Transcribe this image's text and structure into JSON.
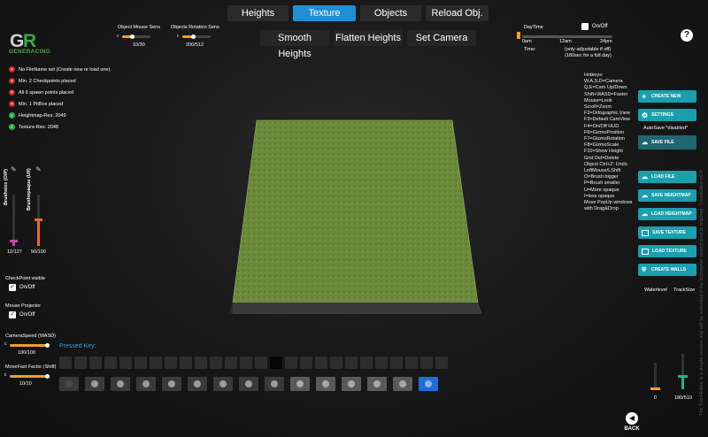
{
  "tabs": [
    {
      "label": "Heights",
      "active": false
    },
    {
      "label": "Texture",
      "active": true
    },
    {
      "label": "Objects",
      "active": false
    },
    {
      "label": "Reload Obj.",
      "active": false
    }
  ],
  "tools": {
    "smooth": "Smooth Heights",
    "flatten": "Flatten Heights",
    "camera": "Set Camera"
  },
  "logo": {
    "text": "GENERACING",
    "letters": "GR"
  },
  "mouse_sens": {
    "label": "Object Mouse Sens",
    "value": "10/30",
    "level": 0.33
  },
  "rot_sens": {
    "label": "Objects Rotation Sens",
    "value": "200/512",
    "level": 0.39
  },
  "daytime": {
    "label": "DayTime",
    "toggle_label": "On/Off",
    "t0": "0am",
    "t1": "12am",
    "t2": "24pm",
    "time_label": "Time:",
    "note1": "(only adjustable if off)",
    "note2": "(180sec for a full day)"
  },
  "help_icon": "?",
  "status": [
    {
      "ok": false,
      "text": "No FileName set (Create new or load one)"
    },
    {
      "ok": false,
      "text": "Min. 2 Checkpoints placed"
    },
    {
      "ok": false,
      "text": "All 6 spawn points placed"
    },
    {
      "ok": false,
      "text": "Min. 1 PitBox placed"
    },
    {
      "ok": true,
      "text": "Heightmap-Res: 2049"
    },
    {
      "ok": true,
      "text": "Texture-Res: 2048"
    }
  ],
  "brush": {
    "size_label": "Brushsize (O/P)",
    "opaque_label": "Brushopaque (U/I)",
    "size_value": "12/127",
    "opaque_value": "50/100",
    "size_level": 0.094,
    "opaque_level": 0.5
  },
  "checkpoint": {
    "label": "CheckPoint visible",
    "toggle": "On/Off"
  },
  "projector": {
    "label": "Mouse Projector",
    "toggle": "On/Off"
  },
  "camspeed": {
    "label": "CameraSpeed (WASD)",
    "value": "100/100",
    "level": 1.0
  },
  "movefast": {
    "label": "MoveFast Factor (Shift)",
    "value": "10/10",
    "level": 1.0
  },
  "pressed_key_label": "Pressed Key:",
  "hotkeys": [
    "Hotkeys:",
    "W,A,S,D=Camera",
    "Q,E=Cam Up/Down",
    "Shift+WASD=Faster",
    "Mouse=Look",
    "Scroll=Zoom",
    "F2=Ortographic View",
    "F3=Default CamView",
    "F4=On/Off HUD",
    "F6=GizmoPosition",
    "F7=GizmoRotation",
    "F8=GizmoScale",
    "F10=Show Height",
    "Grid Del=Delete",
    "Object Ctrl+Z: Undo",
    "LeftMouse/LShift",
    "O=Brush bigger",
    "P=Brush smaller",
    "U=More opaque",
    "I=less opaque",
    "Move PopUp windows",
    "with Drag&Drop"
  ],
  "right_buttons": {
    "create": "CREATE NEW",
    "settings": "SETTINGS",
    "autosave": "AutoSave *disabled*",
    "save": "SAVE FILE",
    "load": "LOAD FILE",
    "save_hm": "SAVE HEIGHTMAP",
    "load_hm": "LOAD HEIGHTMAP",
    "save_tex": "SAVE TEXTURE",
    "load_tex": "LOAD TEXTURE",
    "walls": "CREATE WALLS"
  },
  "waterlevel": {
    "label": "Waterlevel",
    "value": "0",
    "level": 0.0
  },
  "tracksize": {
    "label": "TrackSize",
    "value": "180/510",
    "level": 0.35
  },
  "side_note": "The TrackEditor is a simple-version and will be extended if the kickstarter stretch goal is reached.  TrackEditor v0.8",
  "back": {
    "label": "BACK"
  },
  "colors": {
    "accent": "#1e8fd6",
    "teal": "#1a9fae",
    "orange": "#f0a028",
    "terrain": "#6b8a3a"
  }
}
